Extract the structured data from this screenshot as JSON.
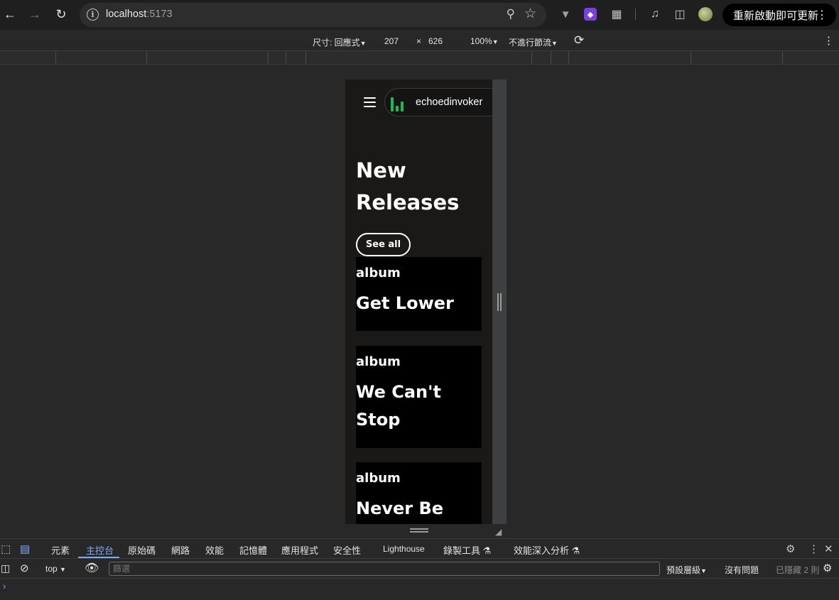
{
  "browser": {
    "url_host": "localhost",
    "url_port": ":5173",
    "update_button": "重新啟動即可更新",
    "icons": {
      "back": "back-arrow-icon",
      "forward": "forward-arrow-icon",
      "reload": "reload-icon",
      "site_info": "info-icon",
      "zoom": "zoom-icon",
      "bookmark": "star-icon",
      "extensions": "puzzle-icon",
      "menu": "kebab-icon"
    }
  },
  "device_toolbar": {
    "dimensions_label": "尺寸: 回應式",
    "width": "207",
    "times": "×",
    "height": "626",
    "zoom": "100%",
    "throttling": "不進行節流"
  },
  "app": {
    "brand_name": "echoedinvoker",
    "brand_color": "#1db954",
    "section_title": "New Releases",
    "see_all_label": "See all",
    "cards": [
      {
        "type": "album",
        "title": "Get Lower"
      },
      {
        "type": "album",
        "title": "We Can't Stop"
      },
      {
        "type": "album",
        "title": "Never Be"
      }
    ]
  },
  "devtools": {
    "tabs": [
      "元素",
      "主控台",
      "原始碼",
      "網路",
      "效能",
      "記憶體",
      "應用程式",
      "安全性",
      "Lighthouse",
      "錄製工具",
      "效能深入分析"
    ],
    "active_tab": "主控台",
    "context": "top",
    "filter_placeholder": "篩選",
    "levels": "預設層級",
    "issues": "沒有問題",
    "hidden": "已隱藏 2 則",
    "prompt": "›"
  }
}
